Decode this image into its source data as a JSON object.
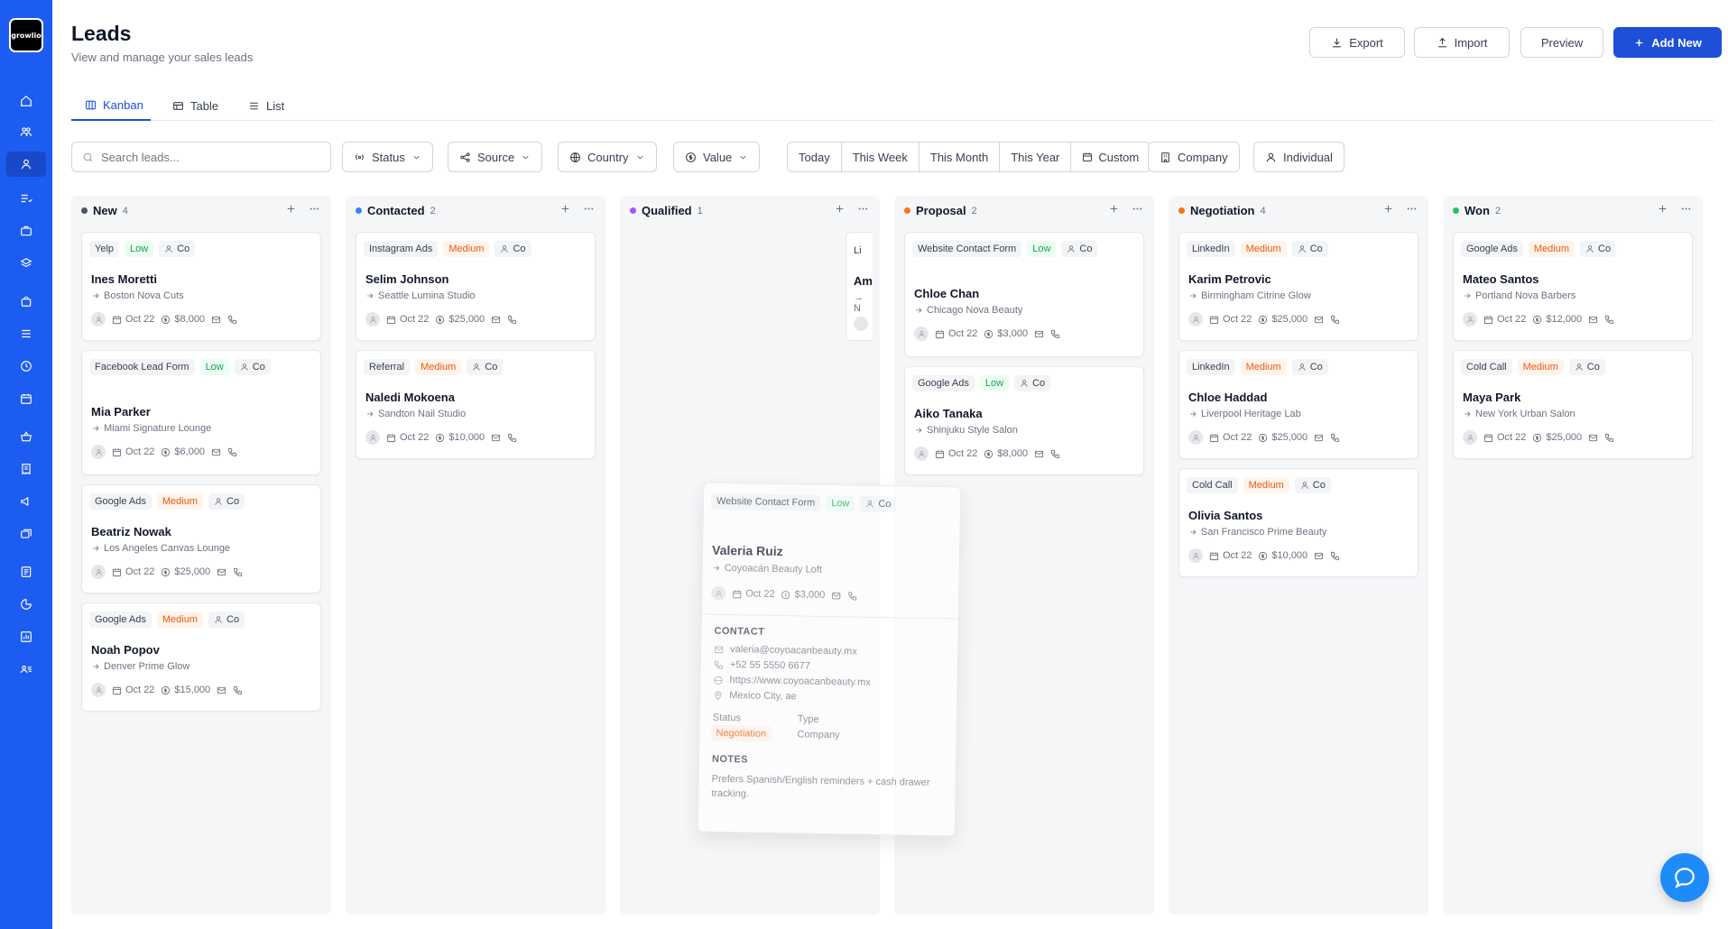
{
  "app": {
    "logo_text": "growlio"
  },
  "header": {
    "title": "Leads",
    "subtitle": "View and manage your sales leads",
    "buttons": {
      "export": "Export",
      "import": "Import",
      "preview": "Preview",
      "add_new": "Add New"
    }
  },
  "tabs": [
    {
      "label": "Kanban",
      "active": true
    },
    {
      "label": "Table",
      "active": false
    },
    {
      "label": "List",
      "active": false
    }
  ],
  "filters": {
    "search_placeholder": "Search leads...",
    "status": "Status",
    "source": "Source",
    "country": "Country",
    "value": "Value",
    "periods": [
      "Today",
      "This Week",
      "This Month",
      "This Year",
      "Custom"
    ],
    "company": "Company",
    "individual": "Individual"
  },
  "columns": [
    {
      "title": "New",
      "count": "4",
      "color": "#4b5563",
      "cards": [
        {
          "source": "Yelp",
          "priority": "Low",
          "type": "Co",
          "name": "Ines Moretti",
          "company": "Boston Nova Cuts",
          "date": "Oct 22",
          "value": "$8,000"
        },
        {
          "source": "Facebook Lead Form",
          "priority": "Low",
          "type": "Co",
          "name": "Mia Parker",
          "company": "Miami Signature Lounge",
          "date": "Oct 22",
          "value": "$6,000"
        },
        {
          "source": "Google Ads",
          "priority": "Medium",
          "type": "Co",
          "name": "Beatriz Nowak",
          "company": "Los Angeles Canvas Lounge",
          "date": "Oct 22",
          "value": "$25,000"
        },
        {
          "source": "Google Ads",
          "priority": "Medium",
          "type": "Co",
          "name": "Noah Popov",
          "company": "Denver Prime Glow",
          "date": "Oct 22",
          "value": "$15,000"
        }
      ]
    },
    {
      "title": "Contacted",
      "count": "2",
      "color": "#3b82f6",
      "cards": [
        {
          "source": "Instagram Ads",
          "priority": "Medium",
          "type": "Co",
          "name": "Selim Johnson",
          "company": "Seattle Lumina Studio",
          "date": "Oct 22",
          "value": "$25,000"
        },
        {
          "source": "Referral",
          "priority": "Medium",
          "type": "Co",
          "name": "Naledi Mokoena",
          "company": "Sandton Nail Studio",
          "date": "Oct 22",
          "value": "$10,000"
        }
      ]
    },
    {
      "title": "Qualified",
      "count": "1",
      "color": "#a855f7",
      "cards": []
    },
    {
      "title": "Proposal",
      "count": "2",
      "color": "#f97316",
      "cards": [
        {
          "source": "Website Contact Form",
          "priority": "Low",
          "type": "Co",
          "name": "Chloe Chan",
          "company": "Chicago Nova Beauty",
          "date": "Oct 22",
          "value": "$3,000"
        },
        {
          "source": "Google Ads",
          "priority": "Low",
          "type": "Co",
          "name": "Aiko Tanaka",
          "company": "Shinjuku Style Salon",
          "date": "Oct 22",
          "value": "$8,000"
        }
      ]
    },
    {
      "title": "Negotiation",
      "count": "4",
      "color": "#f97316",
      "cards": [
        {
          "source": "LinkedIn",
          "priority": "Medium",
          "type": "Co",
          "name": "Karim Petrovic",
          "company": "Birmingham Citrine Glow",
          "date": "Oct 22",
          "value": "$25,000"
        },
        {
          "source": "LinkedIn",
          "priority": "Medium",
          "type": "Co",
          "name": "Chloe Haddad",
          "company": "Liverpool Heritage Lab",
          "date": "Oct 22",
          "value": "$25,000"
        },
        {
          "source": "Cold Call",
          "priority": "Medium",
          "type": "Co",
          "name": "Olivia Santos",
          "company": "San Francisco Prime Beauty",
          "date": "Oct 22",
          "value": "$10,000"
        }
      ]
    },
    {
      "title": "Won",
      "count": "2",
      "color": "#22c55e",
      "cards": [
        {
          "source": "Google Ads",
          "priority": "Medium",
          "type": "Co",
          "name": "Mateo Santos",
          "company": "Portland Nova Barbers",
          "date": "Oct 22",
          "value": "$12,000"
        },
        {
          "source": "Cold Call",
          "priority": "Medium",
          "type": "Co",
          "name": "Maya Park",
          "company": "New York Urban Salon",
          "date": "Oct 22",
          "value": "$25,000"
        }
      ]
    }
  ],
  "qualified_peek": {
    "source": "Li",
    "name": "Am",
    "company": "→ N"
  },
  "dragging_card": {
    "source": "Website Contact Form",
    "priority": "Low",
    "type": "Co",
    "name": "Valeria Ruiz",
    "company": "Coyoacán Beauty Loft",
    "date": "Oct 22",
    "value": "$3,000",
    "contact_label": "CONTACT",
    "email": "valeria@coyoacanbeauty.mx",
    "phone": "+52 55 5550 6677",
    "website": "https://www.coyoacanbeauty.mx",
    "location": "Mexico City, ae",
    "status_label": "Status",
    "status_value": "Negotiation",
    "type_label": "Type",
    "type_value": "Company",
    "notes_label": "NOTES",
    "notes": "Prefers Spanish/English reminders + cash drawer tracking."
  }
}
